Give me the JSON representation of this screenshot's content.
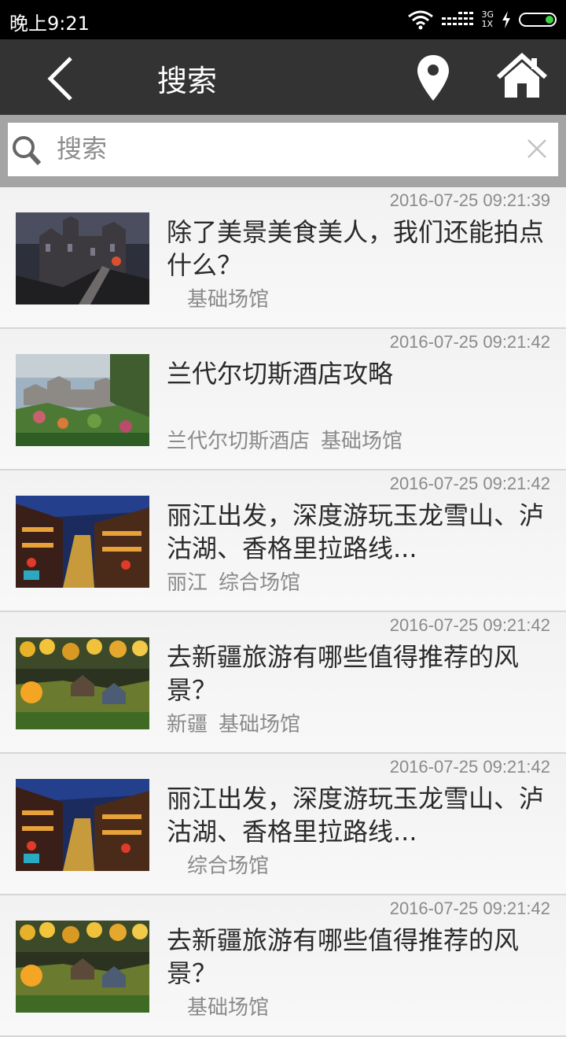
{
  "status_bar": {
    "time": "晚上9:21",
    "network_top": "3G",
    "network_bottom": "1X"
  },
  "header": {
    "title": "搜索"
  },
  "search": {
    "placeholder": "搜索",
    "value": ""
  },
  "items": [
    {
      "date": "2016-07-25 09:21:39",
      "title": "除了美景美食美人，我们还能拍点什么？",
      "tags": [
        "",
        "基础场馆"
      ]
    },
    {
      "date": "2016-07-25 09:21:42",
      "title": "兰代尔切斯酒店攻略",
      "tags": [
        "兰代尔切斯酒店",
        "基础场馆"
      ]
    },
    {
      "date": "2016-07-25 09:21:42",
      "title": "丽江出发，深度游玩玉龙雪山、泸沽湖、香格里拉路线...",
      "tags": [
        "丽江",
        "综合场馆"
      ]
    },
    {
      "date": "2016-07-25 09:21:42",
      "title": "去新疆旅游有哪些值得推荐的风景？",
      "tags": [
        "新疆",
        "基础场馆"
      ]
    },
    {
      "date": "2016-07-25 09:21:42",
      "title": "丽江出发，深度游玩玉龙雪山、泸沽湖、香格里拉路线...",
      "tags": [
        "",
        "综合场馆"
      ]
    },
    {
      "date": "2016-07-25 09:21:42",
      "title": "去新疆旅游有哪些值得推荐的风景？",
      "tags": [
        "",
        "基础场馆"
      ]
    }
  ],
  "colors": {
    "header_bg": "#333333",
    "search_bg": "#a4a4a4",
    "battery": "#3fd13f"
  }
}
